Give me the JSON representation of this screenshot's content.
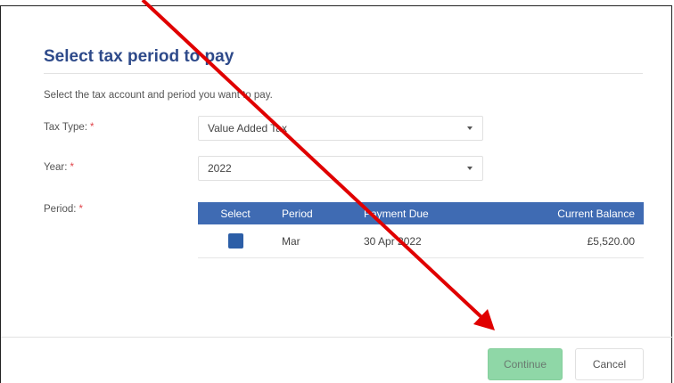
{
  "dialog": {
    "title": "Select tax period to pay",
    "instructions": "Select the tax account and period you want to pay."
  },
  "form": {
    "tax_type": {
      "label": "Tax Type:",
      "required_mark": "*",
      "value": "Value Added Tax"
    },
    "year": {
      "label": "Year:",
      "required_mark": "*",
      "value": "2022"
    },
    "period": {
      "label": "Period:",
      "required_mark": "*"
    }
  },
  "table": {
    "headers": [
      "Select",
      "Period",
      "Payment Due",
      "Current Balance"
    ],
    "rows": [
      {
        "checked": true,
        "period": "Mar",
        "payment_due": "30 Apr 2022",
        "balance": "£5,520.00"
      }
    ]
  },
  "footer": {
    "continue_label": "Continue",
    "cancel_label": "Cancel"
  },
  "colors": {
    "title": "#2e4a8a",
    "table_header": "#3f6bb3",
    "checkbox": "#2c5ea7",
    "continue_button": "#8fd7a7",
    "required": "#e0454a",
    "annotation_arrow": "#e00000"
  }
}
